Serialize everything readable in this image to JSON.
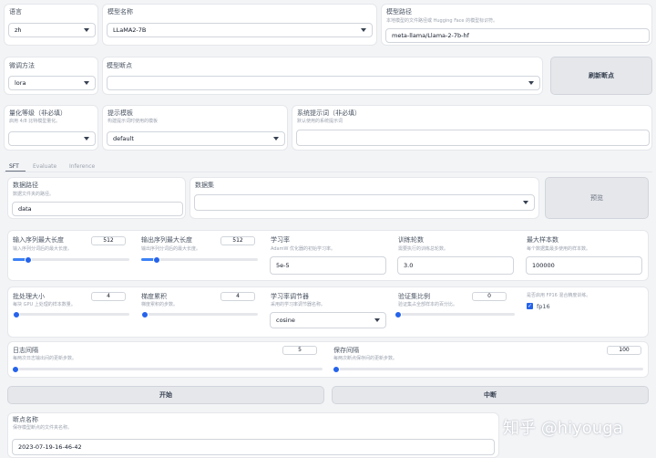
{
  "row1": {
    "lang": {
      "label": "语言",
      "value": "zh"
    },
    "model_name": {
      "label": "模型名称",
      "value": "LLaMA2-7B"
    },
    "model_path": {
      "label": "模型路径",
      "sub": "本地模型的文件路径或 Hugging Face 的模型标识符。",
      "value": "meta-llama/Llama-2-7b-hf"
    }
  },
  "row2": {
    "finetune": {
      "label": "微调方法",
      "value": "lora"
    },
    "checkpoints": {
      "label": "模型断点",
      "value": ""
    },
    "refresh_label": "刷新断点"
  },
  "row3": {
    "quant": {
      "label": "量化等级（非必填）",
      "sub": "启用 4/8 比特模型量化。",
      "value": ""
    },
    "template": {
      "label": "提示模板",
      "sub": "构建提示词时使用的模板",
      "value": "default"
    },
    "system_prompt": {
      "label": "系统提示词（非必填）",
      "sub": "默认使用的系统提示词",
      "value": ""
    }
  },
  "tabs": [
    "SFT",
    "Evaluate",
    "Inference"
  ],
  "data": {
    "dir": {
      "label": "数据路径",
      "sub": "数据文件夹的路径。",
      "value": "data"
    },
    "dataset": {
      "label": "数据集",
      "value": ""
    },
    "preview_label": "预览"
  },
  "params": {
    "cutoff_len": {
      "label": "输入序列最大长度",
      "sub": "输入序列分词后的最大长度。",
      "value": "512",
      "fraction": 0.13
    },
    "max_target_len": {
      "label": "输出序列最大长度",
      "sub": "输出序列分词后的最大长度。",
      "value": "512",
      "fraction": 0.13
    },
    "learning_rate": {
      "label": "学习率",
      "sub": "AdamW 优化器的初始学习率。",
      "value": "5e-5"
    },
    "epochs": {
      "label": "训练轮数",
      "sub": "需要执行的训练总轮数。",
      "value": "3.0"
    },
    "max_samples": {
      "label": "最大样本数",
      "sub": "每个数据集最多使用的样本数。",
      "value": "100000"
    },
    "batch_size": {
      "label": "批处理大小",
      "sub": "每块 GPU 上处理的样本数量。",
      "value": "4",
      "fraction": 0.03
    },
    "grad_accum": {
      "label": "梯度累积",
      "sub": "梯度累积的步数。",
      "value": "4",
      "fraction": 0.03
    },
    "lr_scheduler": {
      "label": "学习率调节器",
      "sub": "采用的学习率调节器名称。",
      "value": "cosine"
    },
    "val_size": {
      "label": "验证集比例",
      "sub": "验证集占全部样本的百分比。",
      "value": "0",
      "fraction": 0.0
    },
    "fp16": {
      "sub": "是否启用 FP16 混合精度训练。",
      "label": "fp16"
    },
    "logging_steps": {
      "label": "日志间隔",
      "sub": "每两次日志输出间的更新步数。",
      "value": "5",
      "fraction": 0.01
    },
    "save_steps": {
      "label": "保存间隔",
      "sub": "每两次断点保存间的更新步数。",
      "value": "100",
      "fraction": 0.01
    }
  },
  "actions": {
    "start": "开始",
    "stop": "中断"
  },
  "output": {
    "label": "断点名称",
    "sub": "保存模型断点的文件夹名称。",
    "value": "2023-07-19-16-46-42"
  },
  "watermark": "知乎 @hiyouga",
  "colors": {
    "accent": "#2563eb",
    "panel": "#ffffff",
    "background": "#f3f4f6"
  }
}
